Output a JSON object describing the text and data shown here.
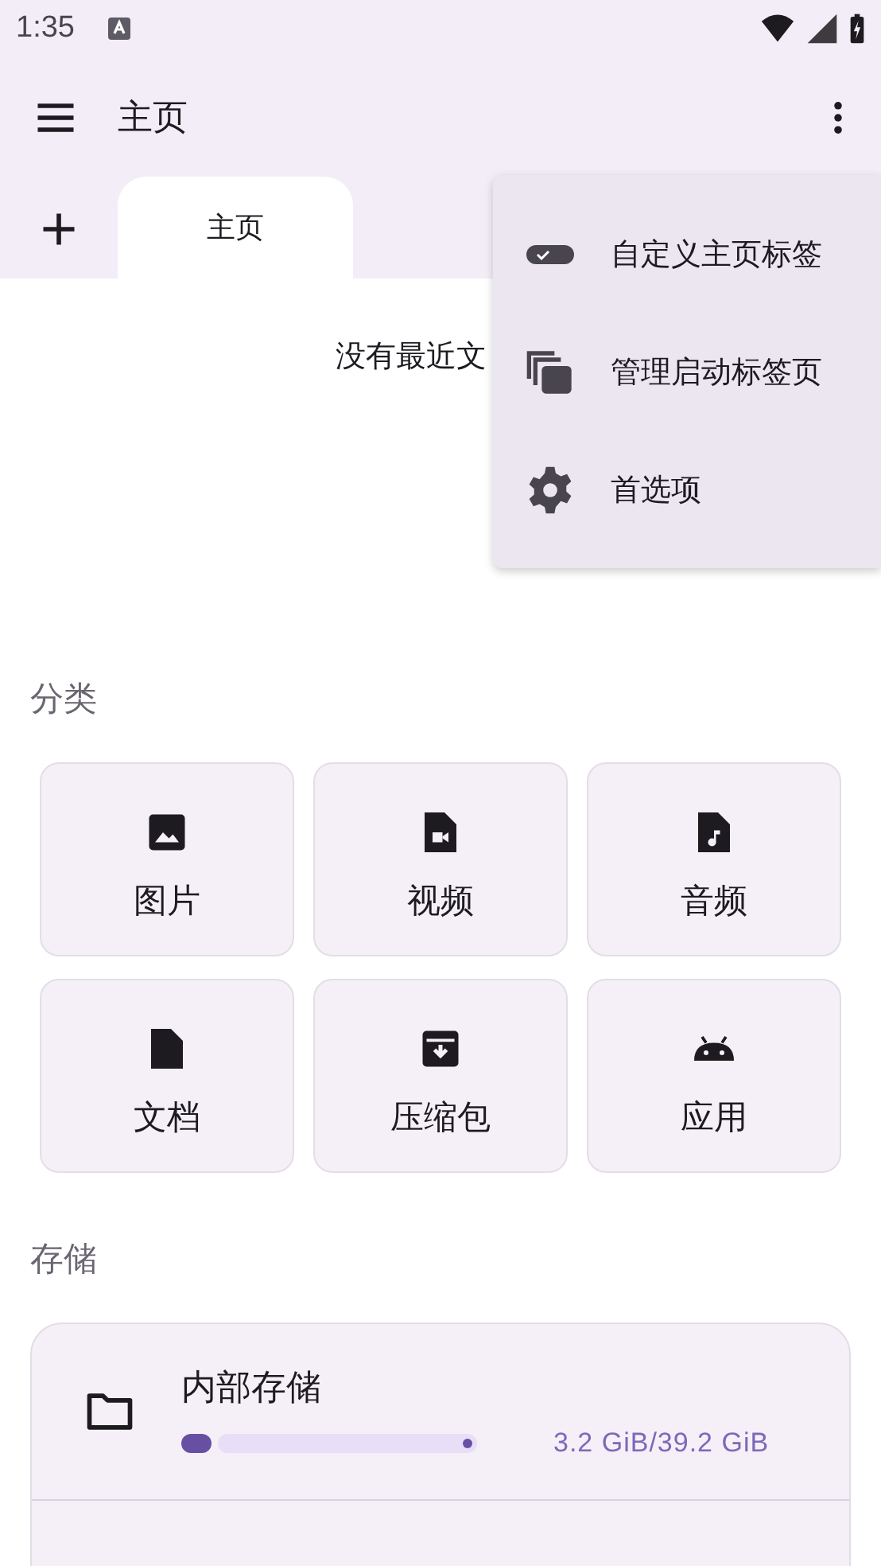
{
  "status_bar": {
    "time": "1:35"
  },
  "app_bar": {
    "title": "主页"
  },
  "tabs": [
    {
      "label": "主页",
      "selected": true
    }
  ],
  "recent": {
    "empty_text": "没有最近文"
  },
  "menu": {
    "items": [
      {
        "kind": "toggle",
        "label": "自定义主页标签"
      },
      {
        "kind": "tabs",
        "label": "管理启动标签页"
      },
      {
        "kind": "settings",
        "label": "首选项"
      }
    ]
  },
  "categories": {
    "title": "分类",
    "items": [
      {
        "kind": "image",
        "label": "图片"
      },
      {
        "kind": "video",
        "label": "视频"
      },
      {
        "kind": "audio",
        "label": "音频"
      },
      {
        "kind": "document",
        "label": "文档"
      },
      {
        "kind": "archive",
        "label": "压缩包"
      },
      {
        "kind": "app",
        "label": "应用"
      }
    ]
  },
  "storage": {
    "title": "存储",
    "items": [
      {
        "kind": "folder",
        "name": "内部存储",
        "level": 0.1,
        "usage": "3.2 GiB/39.2 GiB"
      }
    ]
  }
}
